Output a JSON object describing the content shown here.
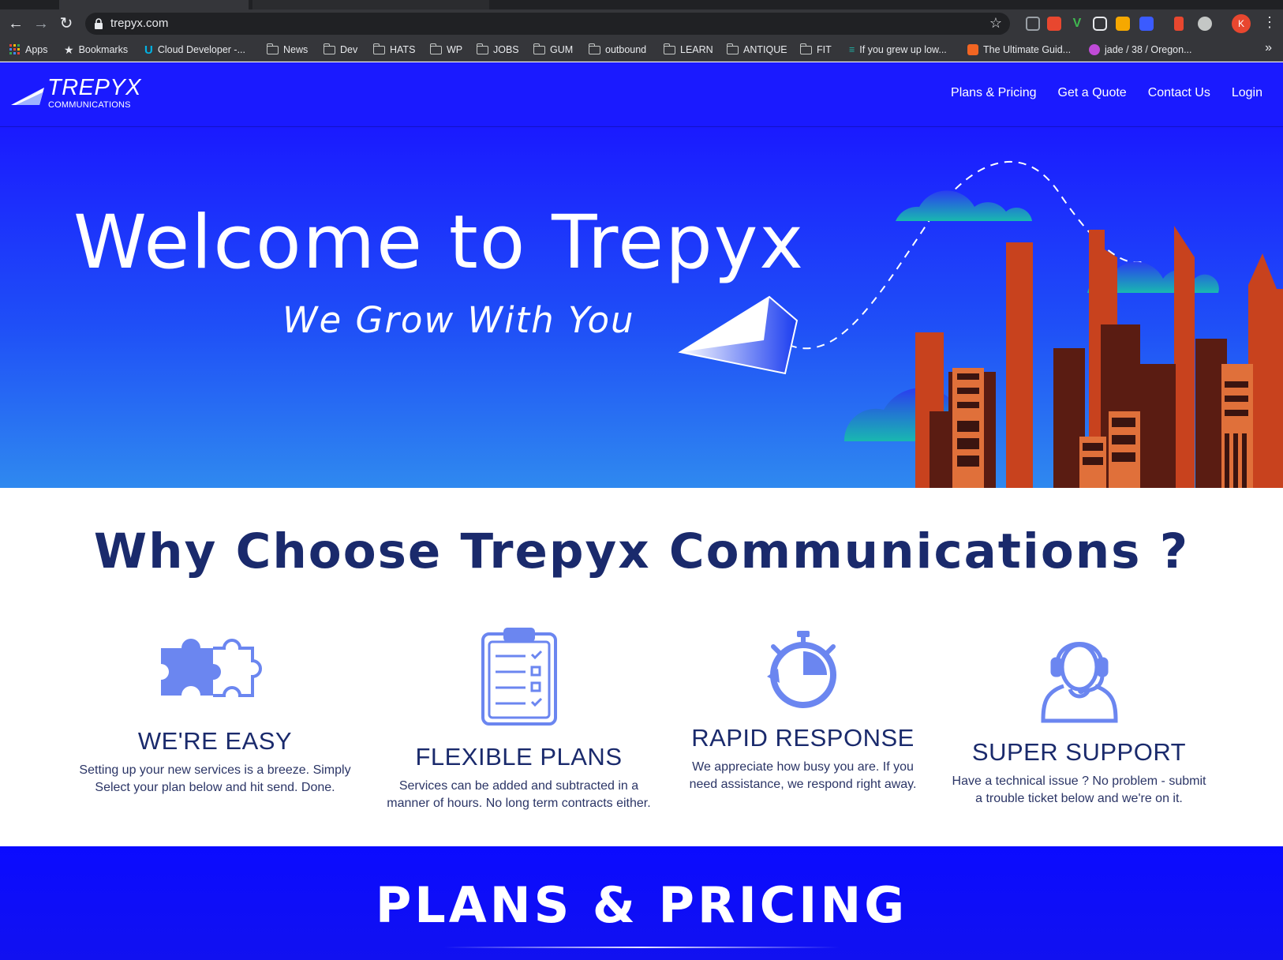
{
  "browser": {
    "url": "trepyx.com",
    "profile_initial": "K",
    "bookmarks": [
      {
        "label": "Apps",
        "icon": "apps-grid-icon"
      },
      {
        "label": "Bookmarks",
        "icon": "star-icon"
      },
      {
        "label": "Cloud Developer -...",
        "icon": "udacity-icon"
      },
      {
        "label": "News",
        "icon": "folder-icon"
      },
      {
        "label": "Dev",
        "icon": "folder-icon"
      },
      {
        "label": "HATS",
        "icon": "folder-icon"
      },
      {
        "label": "WP",
        "icon": "folder-icon"
      },
      {
        "label": "JOBS",
        "icon": "folder-icon"
      },
      {
        "label": "GUM",
        "icon": "folder-icon"
      },
      {
        "label": "outbound",
        "icon": "folder-icon"
      },
      {
        "label": "LEARN",
        "icon": "folder-icon"
      },
      {
        "label": "ANTIQUE",
        "icon": "folder-icon"
      },
      {
        "label": "FIT",
        "icon": "folder-icon"
      },
      {
        "label": "If you grew up low...",
        "icon": "ladder-icon"
      },
      {
        "label": "The Ultimate Guid...",
        "icon": "site-icon"
      },
      {
        "label": "jade / 38 / Oregon...",
        "icon": "site-icon"
      }
    ],
    "more_bookmarks": "»"
  },
  "site": {
    "logo_word": "TREPYX",
    "logo_sub": "COMMUNICATIONS",
    "nav": [
      "Plans & Pricing",
      "Get a Quote",
      "Contact Us",
      "Login"
    ],
    "hero_title": "Welcome to Trepyx",
    "hero_subtitle": "We Grow With You",
    "why_title": "Why Choose Trepyx Communications ?",
    "features": [
      {
        "title": "WE'RE EASY",
        "desc_line1": "Setting up your new services is a breeze. Simply",
        "desc_line2": "Select your plan below and hit send. Done.",
        "icon": "puzzle-icon"
      },
      {
        "title": "FLEXIBLE PLANS",
        "desc_line1": "Services can be added and subtracted in a",
        "desc_line2": "manner of hours. No long term contracts either.",
        "icon": "clipboard-checklist-icon"
      },
      {
        "title": "RAPID RESPONSE",
        "desc_line1": "We appreciate how busy you are. If you",
        "desc_line2": "need assistance, we respond right away.",
        "icon": "stopwatch-icon"
      },
      {
        "title": "SUPER SUPPORT",
        "desc_line1": "Have a technical issue ? No problem - submit",
        "desc_line2": "a trouble ticket below and we're on it.",
        "icon": "support-agent-icon"
      }
    ],
    "plans_title": "PLANS & PRICING"
  },
  "colors": {
    "header_blue": "#1a1aff",
    "navy_text": "#1a2a6c",
    "icon_blue": "#6b86f0",
    "building_orange": "#c8421e"
  }
}
